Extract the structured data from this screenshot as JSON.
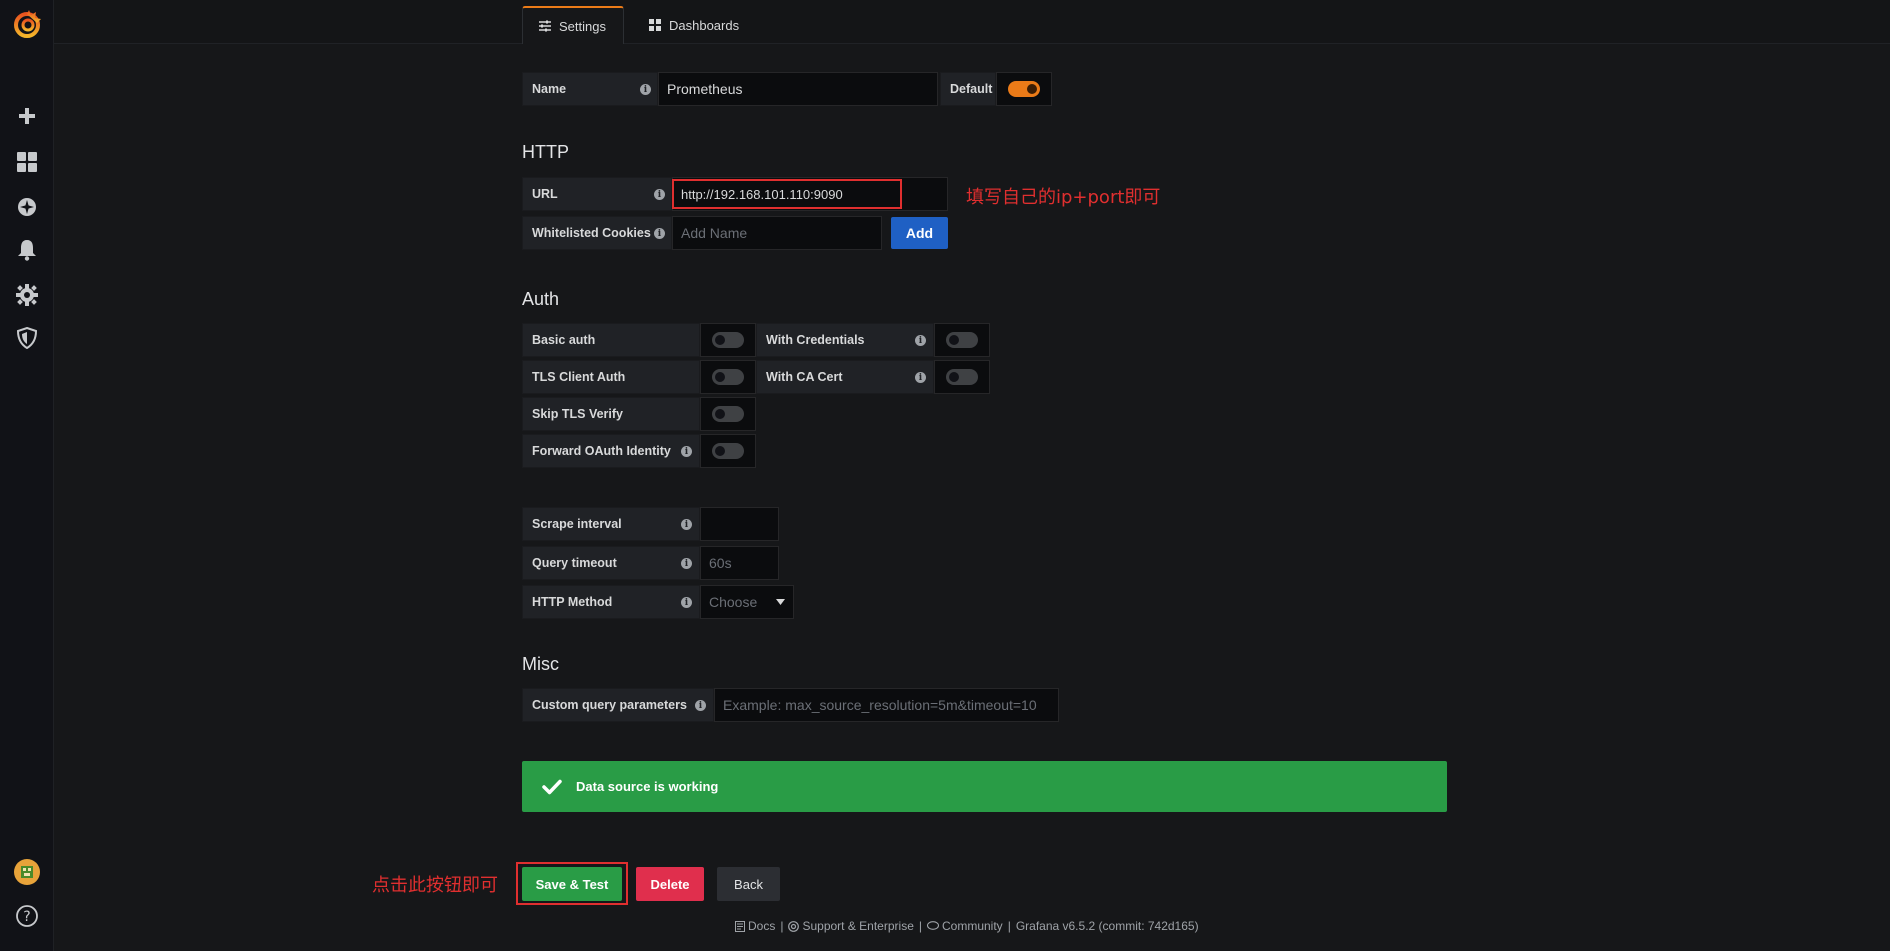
{
  "tabs": [
    {
      "label": "Settings",
      "icon": "sliders-icon"
    },
    {
      "label": "Dashboards",
      "icon": "grid-icon"
    }
  ],
  "name_row": {
    "label": "Name",
    "value": "Prometheus",
    "default_label": "Default",
    "default_on": true
  },
  "http": {
    "title": "HTTP",
    "url_label": "URL",
    "url_value": "http://192.168.101.110:9090",
    "cookies_label": "Whitelisted Cookies",
    "cookies_placeholder": "Add Name",
    "add_label": "Add"
  },
  "auth": {
    "title": "Auth",
    "basic_auth": "Basic auth",
    "with_credentials": "With Credentials",
    "tls_client_auth": "TLS Client Auth",
    "with_ca_cert": "With CA Cert",
    "skip_tls": "Skip TLS Verify",
    "forward_oauth": "Forward OAuth Identity"
  },
  "prom": {
    "scrape_label": "Scrape interval",
    "scrape_value": "",
    "timeout_label": "Query timeout",
    "timeout_placeholder": "60s",
    "method_label": "HTTP Method",
    "method_placeholder": "Choose"
  },
  "misc": {
    "title": "Misc",
    "custom_label": "Custom query parameters",
    "custom_placeholder": "Example: max_source_resolution=5m&timeout=10"
  },
  "alert": {
    "text": "Data source is working",
    "color": "#299c46"
  },
  "buttons": {
    "save": "Save & Test",
    "delete": "Delete",
    "back": "Back"
  },
  "annotations": {
    "url_note": "填写自己的ip+port即可",
    "save_note": "点击此按钮即可"
  },
  "footer": {
    "docs": "Docs",
    "support": "Support & Enterprise",
    "community": "Community",
    "version": "Grafana v6.5.2 (commit: 742d165)"
  },
  "colors": {
    "accent": "#eb7b18",
    "success": "#299c46",
    "danger": "#e02f4d",
    "primary": "#1f60c4"
  }
}
